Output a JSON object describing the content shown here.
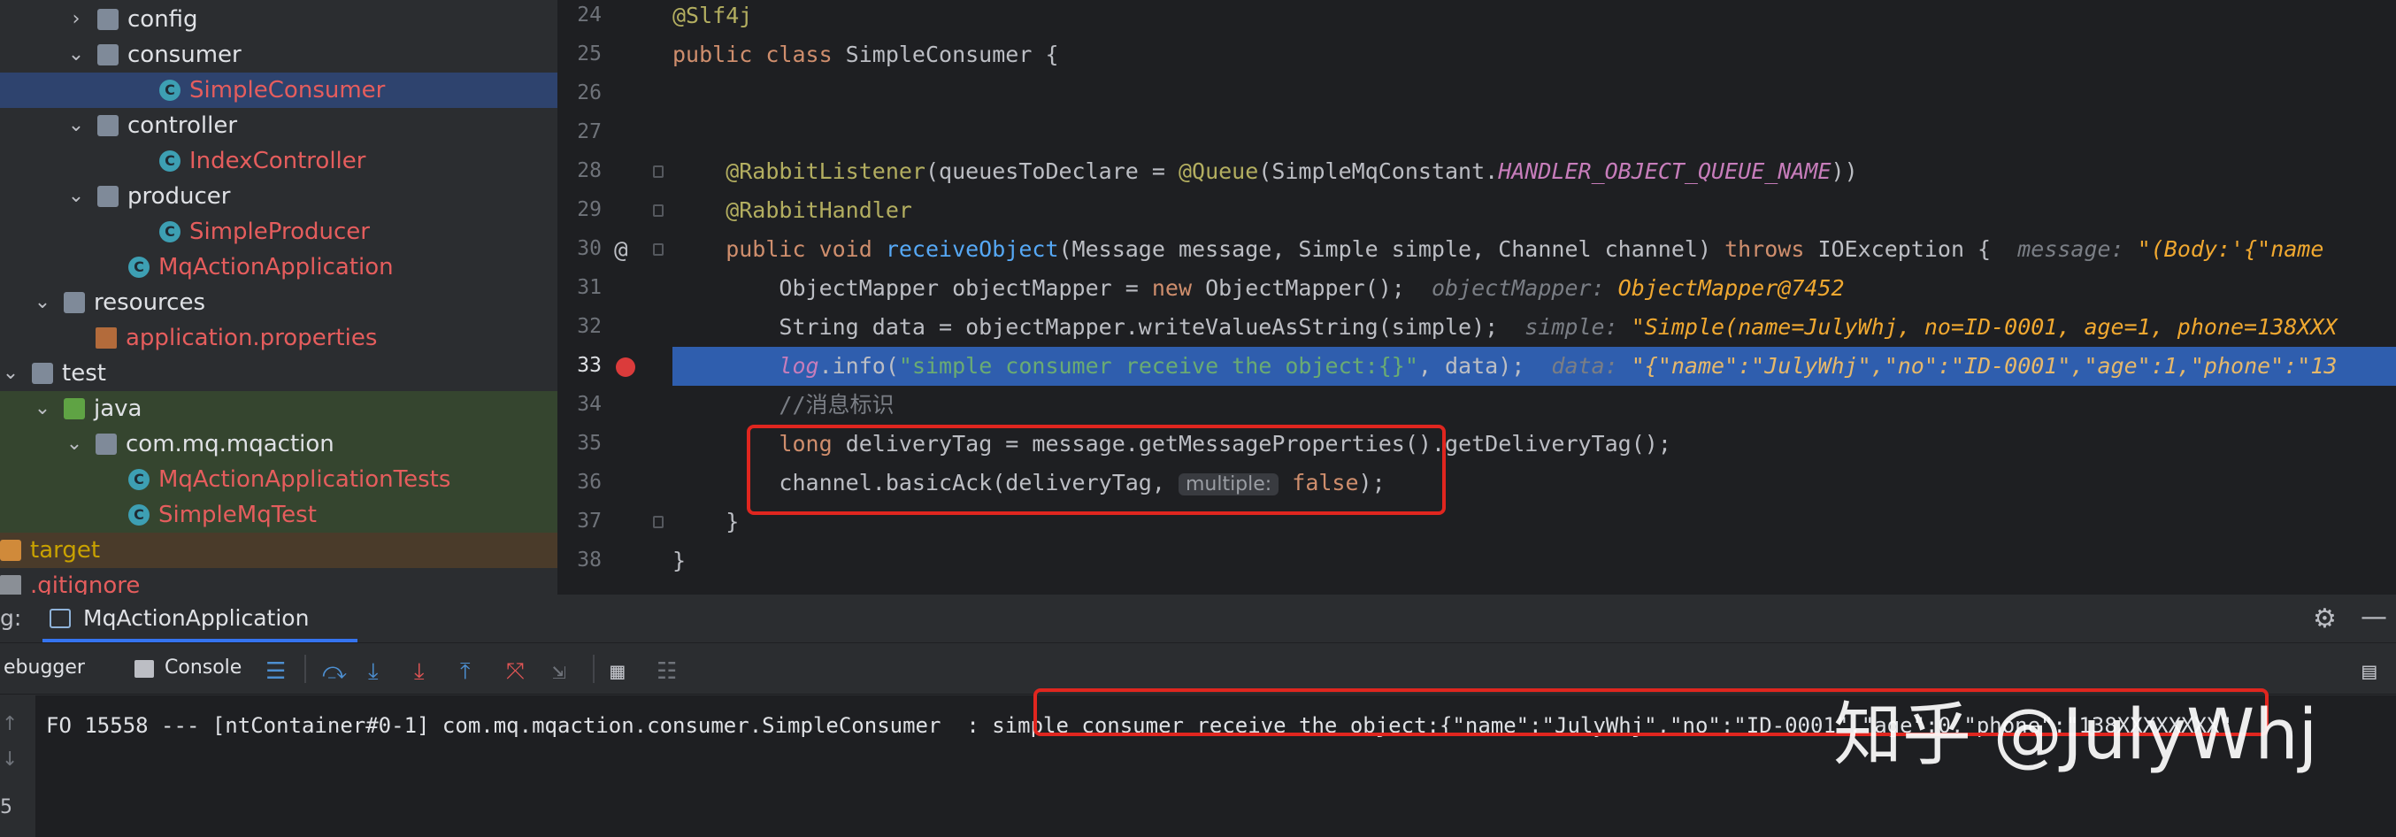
{
  "tree": {
    "items": [
      {
        "label": "config",
        "kind": "folder",
        "color": "white",
        "chev": "›",
        "indent": 110
      },
      {
        "label": "consumer",
        "kind": "folder",
        "color": "white",
        "chev": "⌄",
        "indent": 110
      },
      {
        "label": "SimpleConsumer",
        "kind": "class",
        "color": "red",
        "indent": 180,
        "row": "sel"
      },
      {
        "label": "controller",
        "kind": "folder",
        "color": "white",
        "chev": "⌄",
        "indent": 110
      },
      {
        "label": "IndexController",
        "kind": "class",
        "color": "red",
        "indent": 180
      },
      {
        "label": "producer",
        "kind": "folder",
        "color": "white",
        "chev": "⌄",
        "indent": 110
      },
      {
        "label": "SimpleProducer",
        "kind": "class",
        "color": "red",
        "indent": 180
      },
      {
        "label": "MqActionApplication",
        "kind": "class",
        "color": "red",
        "indent": 145
      },
      {
        "label": "resources",
        "kind": "folder",
        "color": "white",
        "chev": "⌄",
        "indent": 72
      },
      {
        "label": "application.properties",
        "kind": "props",
        "color": "red",
        "indent": 108
      },
      {
        "label": "test",
        "kind": "folder",
        "color": "white",
        "chev": "⌄",
        "indent": 36
      },
      {
        "label": "java",
        "kind": "folder-green",
        "color": "white",
        "chev": "⌄",
        "indent": 72,
        "row": "green"
      },
      {
        "label": "com.mq.mqaction",
        "kind": "folder",
        "color": "white",
        "chev": "⌄",
        "indent": 108,
        "row": "green"
      },
      {
        "label": "MqActionApplicationTests",
        "kind": "class",
        "color": "red",
        "indent": 145,
        "row": "green"
      },
      {
        "label": "SimpleMqTest",
        "kind": "class",
        "color": "red",
        "indent": 145,
        "row": "green"
      },
      {
        "label": "target",
        "kind": "folder-orange",
        "color": "yellow",
        "indent": 0,
        "row": "orange"
      },
      {
        "label": ".gitignore",
        "kind": "file",
        "color": "red",
        "indent": 0
      }
    ]
  },
  "editor": {
    "line_numbers": [
      "24",
      "25",
      "26",
      "27",
      "28",
      "29",
      "30",
      "31",
      "32",
      "33",
      "34",
      "35",
      "36",
      "37",
      "38"
    ],
    "breakpoint_line": "33",
    "override_marker": "@",
    "lines": [
      [
        {
          "t": "@Slf4j",
          "c": "ann"
        }
      ],
      [
        {
          "t": "public class ",
          "c": "kw"
        },
        {
          "t": "SimpleConsumer {",
          "c": ""
        }
      ],
      [],
      [],
      [
        {
          "t": "    @RabbitListener",
          "c": "ann"
        },
        {
          "t": "(queuesToDeclare = ",
          "c": ""
        },
        {
          "t": "@Queue",
          "c": "ann"
        },
        {
          "t": "(SimpleMqConstant.",
          "c": ""
        },
        {
          "t": "HANDLER_OBJECT_QUEUE_NAME",
          "c": "cst"
        },
        {
          "t": "))",
          "c": ""
        }
      ],
      [
        {
          "t": "    @RabbitHandler",
          "c": "ann"
        }
      ],
      [
        {
          "t": "    public void ",
          "c": "kw"
        },
        {
          "t": "receiveObject",
          "c": "fn"
        },
        {
          "t": "(Message message, Simple simple, Channel channel) ",
          "c": ""
        },
        {
          "t": "throws ",
          "c": "kw"
        },
        {
          "t": "IOException {  ",
          "c": ""
        },
        {
          "t": "message: ",
          "c": "dbgv"
        },
        {
          "t": "\"(Body:'{\"name",
          "c": "dbgs"
        }
      ],
      [
        {
          "t": "        ObjectMapper objectMapper = ",
          "c": ""
        },
        {
          "t": "new ",
          "c": "kw"
        },
        {
          "t": "ObjectMapper();  ",
          "c": ""
        },
        {
          "t": "objectMapper: ",
          "c": "dbgv"
        },
        {
          "t": "ObjectMapper@7452",
          "c": "dbgs"
        }
      ],
      [
        {
          "t": "        String data = objectMapper.writeValueAsString(simple);  ",
          "c": ""
        },
        {
          "t": "simple: ",
          "c": "dbgv"
        },
        {
          "t": "\"Simple(name=JulyWhj, no=ID-0001, age=1, phone=138XXX",
          "c": "dbgs"
        }
      ],
      [
        {
          "t": "        ",
          "c": ""
        },
        {
          "t": "log",
          "c": "cst"
        },
        {
          "t": ".info(",
          "c": ""
        },
        {
          "t": "\"simple consumer receive the object:{}\"",
          "c": "str"
        },
        {
          "t": ", data);  ",
          "c": ""
        },
        {
          "t": "data: ",
          "c": "dbgv"
        },
        {
          "t": "\"{\"name\":\"JulyWhj\",\"no\":\"ID-0001\",\"age\":1,\"phone\":\"13",
          "c": "dbgs"
        }
      ],
      [
        {
          "t": "        //消息标识",
          "c": "cmt"
        }
      ],
      [
        {
          "t": "        ",
          "c": ""
        },
        {
          "t": "long ",
          "c": "kw"
        },
        {
          "t": "deliveryTag = message.getMessageProperties().getDeliveryTag();",
          "c": ""
        }
      ],
      [
        {
          "t": "        channel.basicAck(deliveryTag, ",
          "c": ""
        },
        {
          "t": "multiple:",
          "c": "hint"
        },
        {
          "t": " ",
          "c": ""
        },
        {
          "t": "false",
          "c": "kw"
        },
        {
          "t": ");",
          "c": ""
        }
      ],
      [
        {
          "t": "    }",
          "c": ""
        }
      ],
      [
        {
          "t": "}",
          "c": ""
        }
      ]
    ]
  },
  "debug": {
    "label": "g:",
    "run_config": "MqActionApplication",
    "tab_debugger": "ebugger",
    "tab_console": "Console",
    "log_prefix": "FO 15558 --- [ntContainer#0-1] com.mq.mqaction.consumer.SimpleConsumer  ",
    "log_message": ": simple consumer receive the object:{\"name\":\"JulyWhj\",\"no\":\"ID-0001\",\"age\":0,\"phone\":\"138XXXXXXXX\"",
    "side_digit": "5"
  },
  "watermark": "知乎 @JulyWhj",
  "colors": {
    "accent": "#2f5eae",
    "highlight_box": "#e0261f",
    "breakpoint": "#db3b3b"
  }
}
